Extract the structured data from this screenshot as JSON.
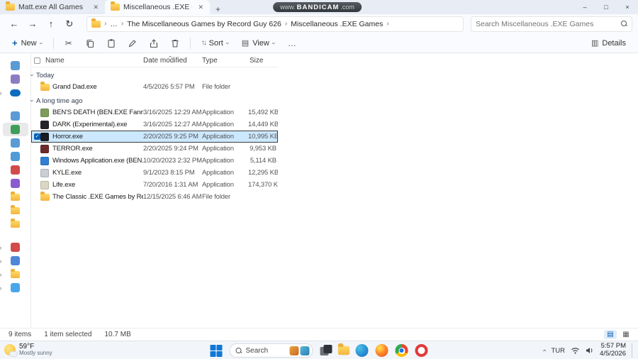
{
  "colors": {
    "accent": "#005fb8",
    "selection_bg": "#cce8ff",
    "folder_yellow": "#f2b53e"
  },
  "window": {
    "tabs": [
      {
        "label": "Matt.exe All Games",
        "active": false
      },
      {
        "label": "Miscellaneous .EXE Games",
        "active": true
      }
    ],
    "watermark": {
      "prefix": "www.",
      "brand": "BANDICAM",
      "suffix": ".com"
    },
    "controls": {
      "minimize": "–",
      "maximize": "□",
      "close": "×"
    }
  },
  "navbar": {
    "breadcrumb_ellipsis": "…",
    "breadcrumb": [
      {
        "label": "The Miscellaneous Games by Record Guy 626"
      },
      {
        "label": "Miscellaneous .EXE Games"
      }
    ],
    "search_placeholder": "Search Miscellaneous .EXE Games"
  },
  "commandbar": {
    "new_label": "New",
    "sort_label": "Sort",
    "view_label": "View",
    "more_label": "…",
    "details_label": "Details"
  },
  "list": {
    "columns": {
      "name": "Name",
      "date": "Date modified",
      "type": "Type",
      "size": "Size"
    },
    "groups": [
      {
        "label": "Today",
        "rows": [
          {
            "name": "Grand Dad.exe",
            "date": "4/5/2026 5:57 PM",
            "type": "File folder",
            "size": "",
            "icon": "folder",
            "icon_color": "#f2b53e",
            "selected": false
          }
        ]
      },
      {
        "label": "A long time ago",
        "rows": [
          {
            "name": "BEN'S DEATH (BEN.EXE Fanmade Cop...",
            "date": "3/16/2025 12:29 AM",
            "type": "Application",
            "size": "15,492 KB",
            "icon": "app",
            "icon_color": "#7d9e5a",
            "selected": false
          },
          {
            "name": "DARK (Experimental).exe",
            "date": "3/16/2025 12:27 AM",
            "type": "Application",
            "size": "14,449 KB",
            "icon": "app",
            "icon_color": "#23232d",
            "selected": false
          },
          {
            "name": "Horror.exe",
            "date": "2/20/2025 9:25 PM",
            "type": "Application",
            "size": "10,995 KB",
            "icon": "app",
            "icon_color": "#1b1b22",
            "selected": true
          },
          {
            "name": "TERROR.exe",
            "date": "2/20/2025 9:24 PM",
            "type": "Application",
            "size": "9,953 KB",
            "icon": "app",
            "icon_color": "#6e2a2a",
            "selected": false
          },
          {
            "name": "Windows Application.exe (BEN.EXE Pa...",
            "date": "10/20/2023 2:32 PM",
            "type": "Application",
            "size": "5,114 KB",
            "icon": "app",
            "icon_color": "#2f7fd4",
            "selected": false
          },
          {
            "name": "KYLE.exe",
            "date": "9/1/2023 8:15 PM",
            "type": "Application",
            "size": "12,295 KB",
            "icon": "app",
            "icon_color": "#c9ced6",
            "selected": false
          },
          {
            "name": "Life.exe",
            "date": "7/20/2016 1:31 AM",
            "type": "Application",
            "size": "174,370 KB",
            "icon": "app",
            "icon_color": "#dad6c2",
            "selected": false
          },
          {
            "name": "The Classic .EXE Games by Record Guy...",
            "date": "12/15/2025 6:46 AM",
            "type": "File folder",
            "size": "",
            "icon": "folder",
            "icon_color": "#f2b53e",
            "selected": false
          }
        ]
      }
    ]
  },
  "sidebar": {
    "items": [
      {
        "name": "home",
        "color": "#5b9bd5",
        "kind": "tile",
        "chevron": false,
        "selected": false,
        "gap_before": false
      },
      {
        "name": "gallery",
        "color": "#8e7cc3",
        "kind": "tile",
        "chevron": false,
        "selected": false,
        "gap_before": false
      },
      {
        "name": "onedrive",
        "color": "#0f6cbd",
        "kind": "circle",
        "chevron": true,
        "selected": false,
        "gap_before": false
      },
      {
        "name": "desktop",
        "color": "#5b9bd5",
        "kind": "tile",
        "chevron": false,
        "selected": false,
        "gap_before": true
      },
      {
        "name": "downloads",
        "color": "#3f9d5a",
        "kind": "tile",
        "chevron": false,
        "selected": true,
        "gap_before": false
      },
      {
        "name": "documents",
        "color": "#5b9bd5",
        "kind": "tile",
        "chevron": false,
        "selected": false,
        "gap_before": false
      },
      {
        "name": "pictures",
        "color": "#4f9bd8",
        "kind": "tile",
        "chevron": false,
        "selected": false,
        "gap_before": false
      },
      {
        "name": "music",
        "color": "#d24b4b",
        "kind": "tile",
        "chevron": false,
        "selected": false,
        "gap_before": false
      },
      {
        "name": "videos",
        "color": "#8a5bd0",
        "kind": "tile",
        "chevron": false,
        "selected": false,
        "gap_before": false
      },
      {
        "name": "pinned-folder-1",
        "color": "#f2b53e",
        "kind": "folder",
        "chevron": false,
        "selected": false,
        "gap_before": false
      },
      {
        "name": "pinned-folder-2",
        "color": "#f2b53e",
        "kind": "folder",
        "chevron": false,
        "selected": false,
        "gap_before": false
      },
      {
        "name": "pinned-folder-3",
        "color": "#f2b53e",
        "kind": "folder",
        "chevron": false,
        "selected": false,
        "gap_before": false
      },
      {
        "name": "recycle-bin",
        "color": "#d24b4b",
        "kind": "tile",
        "chevron": true,
        "selected": false,
        "gap_before": true
      },
      {
        "name": "this-pc",
        "color": "#4f87d8",
        "kind": "tile",
        "chevron": true,
        "selected": false,
        "gap_before": false
      },
      {
        "name": "libraries",
        "color": "#f2b53e",
        "kind": "folder",
        "chevron": true,
        "selected": false,
        "gap_before": false
      },
      {
        "name": "network",
        "color": "#49a6e9",
        "kind": "tile",
        "chevron": true,
        "selected": false,
        "gap_before": false
      }
    ]
  },
  "statusbar": {
    "count": "9 items",
    "selected": "1 item selected",
    "size": "10.7 MB"
  },
  "taskbar": {
    "weather": {
      "temp": "59°F",
      "desc": "Mostly sunny"
    },
    "search_label": "Search",
    "tray": {
      "language": "TUR",
      "time": "5:57 PM",
      "date": "4/5/2026"
    }
  }
}
